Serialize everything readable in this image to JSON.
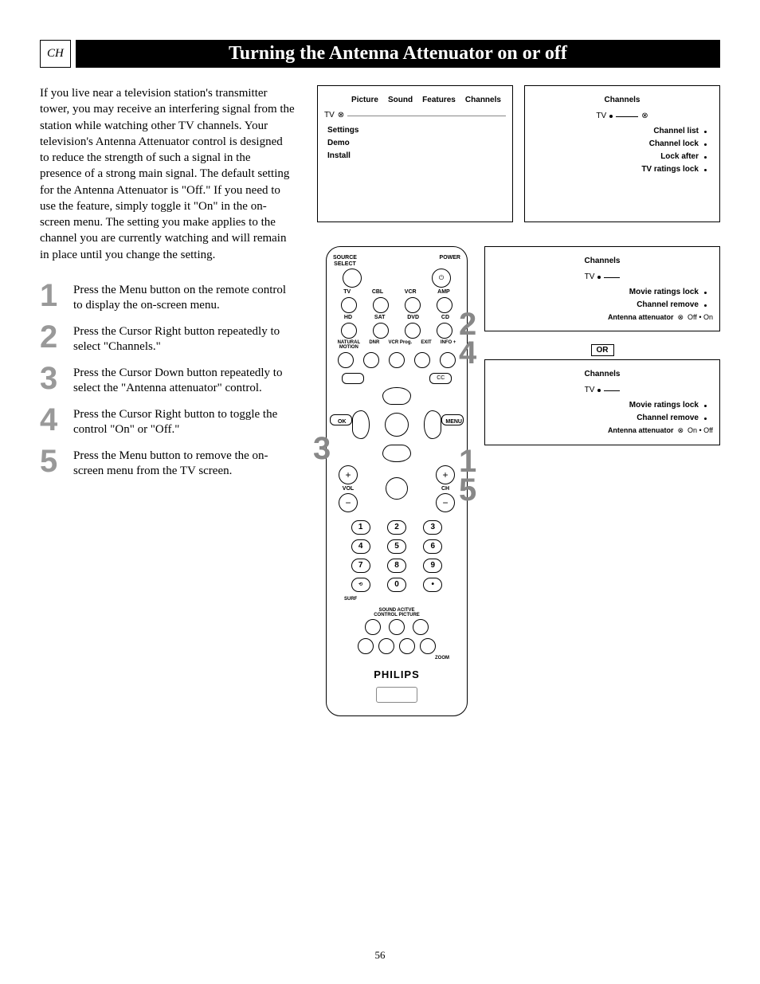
{
  "header": {
    "section_code": "CH",
    "title": "Turning the Antenna Attenuator on or off"
  },
  "intro": "If you live near a television station's transmitter tower, you may receive an interfering signal from the station while watching other TV channels. Your television's Antenna Attenuator control is designed to reduce the strength of such a signal in the presence of a strong main signal. The default setting for the Antenna Attenuator is \"Off.\" If you need to use the feature, simply toggle it \"On\" in the on-screen menu. The setting you make applies to the channel you are currently watching and will remain in place until you change the setting.",
  "steps": [
    {
      "n": "1",
      "text": "Press the Menu button on the remote control to display the on-screen menu."
    },
    {
      "n": "2",
      "text": "Press the Cursor Right button repeatedly to select \"Channels.\""
    },
    {
      "n": "3",
      "text": "Press the Cursor Down button repeatedly to select the \"Antenna attenuator\" control."
    },
    {
      "n": "4",
      "text": "Press the Cursor Right button to toggle the control \"On\" or \"Off.\""
    },
    {
      "n": "5",
      "text": "Press the Menu button to remove the on-screen menu from the TV screen."
    }
  ],
  "menu1": {
    "tabs": [
      "Picture",
      "Sound",
      "Features",
      "Channels"
    ],
    "tv": "TV",
    "left": [
      "Settings",
      "Demo",
      "Install"
    ]
  },
  "menu2": {
    "title": "Channels",
    "tv": "TV",
    "items": [
      "Channel list",
      "Channel lock",
      "Lock after",
      "TV ratings lock"
    ]
  },
  "menu3": {
    "title": "Channels",
    "tv": "TV",
    "items": [
      "Movie ratings lock",
      "Channel remove"
    ],
    "att_label": "Antenna attenuator",
    "att_state": "Off  •  On"
  },
  "menu4": {
    "title": "Channels",
    "tv": "TV",
    "items": [
      "Movie ratings lock",
      "Channel remove"
    ],
    "att_label": "Antenna attenuator",
    "att_state": "On  •  Off"
  },
  "or": "OR",
  "remote": {
    "row1": {
      "l": "SOURCE\nSELECT",
      "r": "POWER"
    },
    "row2": [
      "TV",
      "CBL",
      "VCR",
      "AMP"
    ],
    "row3": [
      "HD",
      "SAT",
      "DVD",
      "CD"
    ],
    "row4": [
      "NATURAL\nMOTION",
      "DNR",
      "VCR Prog.",
      "EXIT",
      "INFO +"
    ],
    "side": {
      "l": "OK",
      "r": "MENU",
      "tl": "▭",
      "tr": "CC"
    },
    "volch": {
      "vol": "VOL",
      "ch": "CH",
      "mute": "🔇"
    },
    "surf": "SURF",
    "bottom_lbl": "SOUND    ACITVE\nCONTROL    PICTURE",
    "zoom": "ZOOM",
    "brand": "PHILIPS",
    "keypad": [
      "1",
      "2",
      "3",
      "4",
      "5",
      "6",
      "7",
      "8",
      "9",
      "",
      "0",
      ""
    ]
  },
  "callouts": {
    "c1": "1",
    "c5": "5",
    "c2": "2",
    "c4": "4",
    "c3": "3"
  },
  "page_number": "56"
}
